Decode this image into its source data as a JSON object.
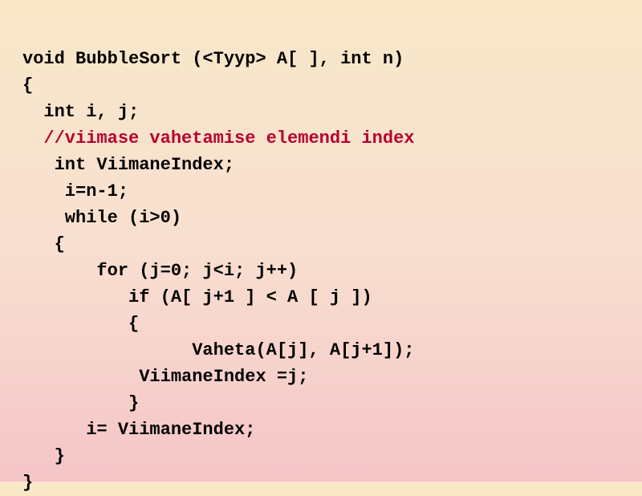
{
  "code": {
    "line1": "void BubbleSort (<Tyyp> A[ ], int n)",
    "line2": "{",
    "line3": "  int i, j;",
    "line4_prefix": "  ",
    "line4_comment": "//viimase vahetamise elemendi index",
    "line5": "   int ViimaneIndex;",
    "line6": "    i=n-1;",
    "line7": "    while (i>0)",
    "line8": "   {",
    "line9": "       for (j=0; j<i; j++)",
    "line10": "          if (A[ j+1 ] < A [ j ])",
    "line11": "          {",
    "line12": "                Vaheta(A[j], A[j+1]);",
    "line13": "           ViimaneIndex =j;",
    "line14": "          }",
    "line15": "      i= ViimaneIndex;",
    "line16": "   }",
    "line17": "}"
  }
}
